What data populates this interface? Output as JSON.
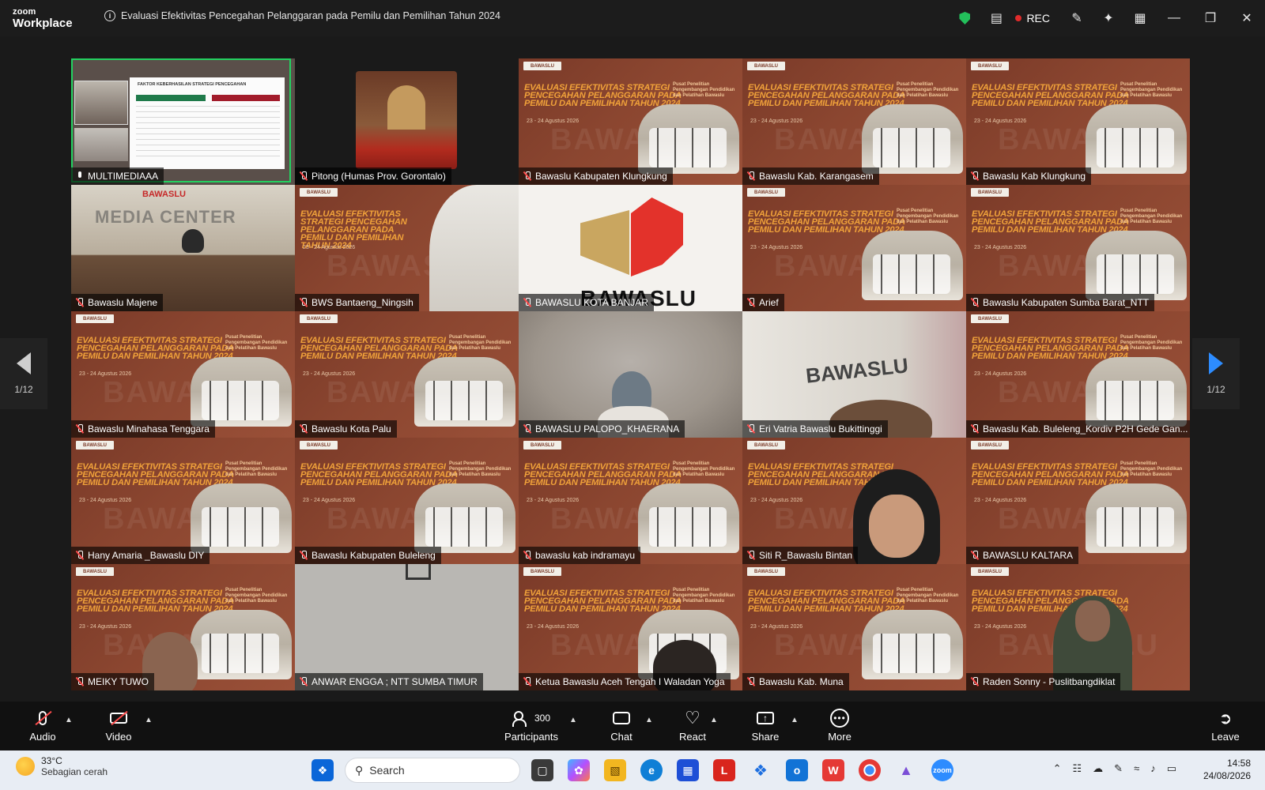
{
  "app": {
    "brand_small": "zoom",
    "brand_large": "Workplace"
  },
  "meeting": {
    "title": "Evaluasi Efektivitas Pencegahan Pelanggaran pada Pemilu dan Pemilihan Tahun 2024",
    "rec_label": "REC"
  },
  "poster": {
    "tag": "BAWASLU",
    "title": "EVALUASI EFEKTIVITAS STRATEGI PENCEGAHAN PELANGGARAN PADA PEMILU DAN PEMILIHAN TAHUN 2024",
    "date": "23 - 24 Agustus 2026",
    "org": "Pusat Penelitian Pengembangan Pendidikan dan Pelatihan Bawaslu",
    "watermark": "BAWASLU"
  },
  "slide": {
    "heading": "FAKTOR KEBERHASILAN STRATEGI PENCEGAHAN"
  },
  "media_center": {
    "sign": "MEDIA CENTER",
    "logo": "BAWASLU"
  },
  "logo_word": "BAWASLU",
  "pagination": {
    "left": "1/12",
    "right": "1/12"
  },
  "participants": [
    "MULTIMEDIAAA",
    "Pitong (Humas Prov. Gorontalo)",
    "Bawaslu Kabupaten Klungkung",
    "Bawaslu Kab. Karangasem",
    "Bawaslu Kab Klungkung",
    "Bawaslu Majene",
    "BWS Bantaeng_Ningsih",
    "BAWASLU KOTA BANJAR",
    "Arief",
    "Bawaslu Kabupaten Sumba Barat_NTT",
    "Bawaslu Minahasa Tenggara",
    "Bawaslu Kota Palu",
    "BAWASLU PALOPO_KHAERANA",
    "Eri Vatria Bawaslu Bukittinggi",
    "Bawaslu Kab. Buleleng_Kordiv P2H Gede Gan...",
    "Hany Amaria _Bawaslu DIY",
    "Bawaslu Kabupaten Buleleng",
    "bawaslu kab indramayu",
    "Siti R_Bawaslu Bintan",
    "BAWASLU KALTARA",
    "MEIKY TUWO",
    "ANWAR ENGGA ; NTT SUMBA TIMUR",
    "Ketua Bawaslu Aceh Tengah I Waladan Yoga",
    "Bawaslu Kab. Muna",
    "Raden Sonny - Puslitbangdiklat"
  ],
  "toolbar": {
    "audio": "Audio",
    "video": "Video",
    "participants_count": "300",
    "participants": "Participants",
    "chat": "Chat",
    "react": "React",
    "share": "Share",
    "more": "More",
    "leave": "Leave"
  },
  "taskbar": {
    "temp": "33°C",
    "weather": "Sebagian cerah",
    "search_placeholder": "Search",
    "time": "14:58",
    "date": "24/08/2026"
  },
  "colors": {
    "active_speaker": "#23d160",
    "rec": "#e02b2b",
    "accent": "#2d8cff",
    "poster_bg": "#8b4630",
    "poster_title": "#f0a23a"
  }
}
